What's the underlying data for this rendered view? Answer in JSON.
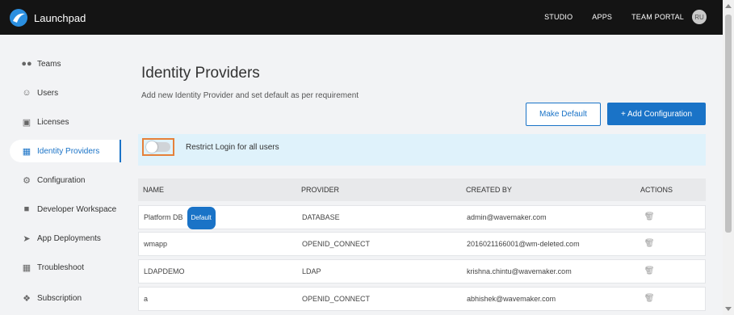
{
  "header": {
    "app_name": "Launchpad",
    "nav": [
      "STUDIO",
      "APPS",
      "TEAM PORTAL"
    ],
    "avatar_initials": "RU"
  },
  "sidebar": {
    "items": [
      {
        "label": "Teams",
        "icon": "teams-icon"
      },
      {
        "label": "Users",
        "icon": "users-icon"
      },
      {
        "label": "Licenses",
        "icon": "licenses-icon"
      },
      {
        "label": "Identity Providers",
        "icon": "identity-icon",
        "active": true
      },
      {
        "label": "Configuration",
        "icon": "configuration-icon"
      },
      {
        "label": "Developer Workspace",
        "icon": "workspace-icon"
      },
      {
        "label": "App Deployments",
        "icon": "deployments-icon"
      },
      {
        "label": "Troubleshoot",
        "icon": "troubleshoot-icon"
      },
      {
        "label": "Subscription",
        "icon": "subscription-icon"
      }
    ]
  },
  "main": {
    "title": "Identity Providers",
    "subtitle": "Add new Identity Provider and set default as per requirement",
    "make_default_label": "Make Default",
    "add_config_label": "+ Add Configuration",
    "restrict_label": "Restrict Login for all users",
    "restrict_enabled": false,
    "table": {
      "headers": [
        "NAME",
        "PROVIDER",
        "CREATED BY",
        "ACTIONS"
      ],
      "rows": [
        {
          "name": "Platform DB",
          "badge": "Default",
          "provider": "DATABASE",
          "created_by": "admin@wavemaker.com"
        },
        {
          "name": "wmapp",
          "provider": "OPENID_CONNECT",
          "created_by": "2016021166001@wm-deleted.com"
        },
        {
          "name": "LDAPDEMO",
          "provider": "LDAP",
          "created_by": "krishna.chintu@wavemaker.com"
        },
        {
          "name": "a",
          "provider": "OPENID_CONNECT",
          "created_by": "abhishek@wavemaker.com"
        }
      ]
    }
  },
  "colors": {
    "accent": "#1a73c7",
    "topbar": "#141414",
    "highlight": "#dff2fb",
    "focus": "#e5813a"
  }
}
